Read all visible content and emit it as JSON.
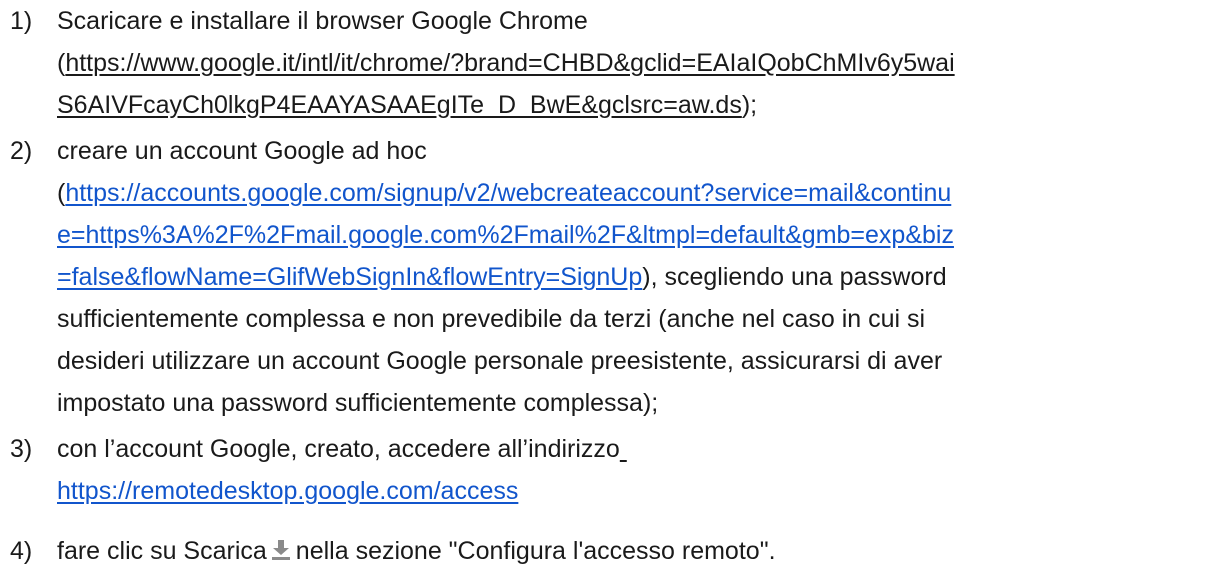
{
  "items": [
    {
      "number": "1)",
      "text_1": "Scaricare e installare il browser Google Chrome",
      "open_paren": "(",
      "link_part1": "https://www.google.it/intl/it/chrome/?brand=CHBD&gclid=EAIaIQobChMIv6y5wai",
      "link_part2": "S6AIVFcayCh0lkgP4EAAYASAAEgITe_D_BwE&gclsrc=aw.ds",
      "tail": ");"
    },
    {
      "number": "2)",
      "text_1": "creare un account Google ad hoc",
      "open_paren": "(",
      "link_part1": "https://accounts.google.com/signup/v2/webcreateaccount?service=mail&continu",
      "link_part2": "e=https%3A%2F%2Fmail.google.com%2Fmail%2F&ltmpl=default&gmb=exp&biz",
      "link_part3": "=false&flowName=GlifWebSignIn&flowEntry=SignUp",
      "tail": "), scegliendo una password",
      "text_4": "sufficientemente complessa e non prevedibile da terzi (anche nel caso in cui si",
      "text_5": "desideri utilizzare un account Google personale preesistente, assicurarsi di aver",
      "text_6": "impostato una password sufficientemente complessa);"
    },
    {
      "number": "3)",
      "text_1": "con l’account Google, creato, accedere all’indirizzo",
      "link": "https://remotedesktop.google.com/access"
    },
    {
      "number": "4)",
      "text_before": "fare clic su Scarica",
      "icon": "download-icon",
      "text_after": "nella sezione \"Configura l'accesso remoto\"."
    }
  ],
  "colors": {
    "link": "#1155cc",
    "text": "#1a1a1a",
    "icon": "#8a8a8a"
  }
}
